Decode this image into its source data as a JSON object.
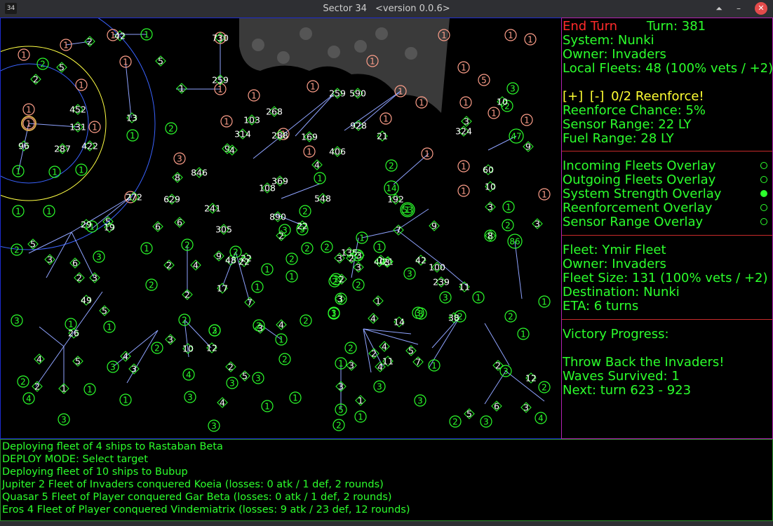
{
  "window": {
    "app_icon_label": "34",
    "title": "Sector 34",
    "version": "<version 0.0.6>",
    "buttons": {
      "pin": "⏶",
      "minimize": "–",
      "close": "✕"
    }
  },
  "status": {
    "end_turn": "End Turn",
    "turn": "Turn: 381",
    "system": "System: Nunki",
    "owner": "Owner: Invaders",
    "local_fleets": "Local Fleets: 48 (100% vets / +2)",
    "reenforce_plus": "[+]",
    "reenforce_minus": "[-]",
    "reenforce": "0/2 Reenforce!",
    "reenforce_chance": "Reenforce Chance: 5%",
    "sensor_range": "Sensor Range: 22 LY",
    "fuel_range": "Fuel Range: 28 LY"
  },
  "overlays": [
    {
      "label": "Incoming Fleets Overlay",
      "selected": false
    },
    {
      "label": "Outgoing Fleets Overlay",
      "selected": false
    },
    {
      "label": "System Strength Overlay",
      "selected": true
    },
    {
      "label": "Reenforcement Overlay",
      "selected": false
    },
    {
      "label": "Sensor Range Overlay",
      "selected": false
    }
  ],
  "fleet": {
    "name": "Fleet: Ymir Fleet",
    "owner": "Owner: Invaders",
    "size": "Fleet Size: 131 (100% vets / +2)",
    "destination": "Destination: Nunki",
    "eta": "ETA: 6 turns"
  },
  "victory": {
    "heading": "Victory Progress:",
    "goal": "Throw Back the Invaders!",
    "waves": "Waves Survived: 1",
    "next": "Next: turn 623 - 923"
  },
  "log": [
    "Deploying fleet of 4 ships to Rastaban Beta",
    "DEPLOY MODE: Select target",
    "Deploying fleet of 10 ships to Bubup",
    "Jupiter 2 Fleet of Invaders conquered Koeia (losses: 0 atk / 1 def, 2 rounds)",
    "Quasar 5 Fleet of Player conquered Gar Beta (losses: 0 atk / 1 def, 2 rounds)",
    "Eros 4 Fleet of Player conquered Vindemiatrix (losses: 9 atk / 23 def, 12 rounds)"
  ],
  "colors": {
    "player": "#2cff2c",
    "invaders": "#ff9f8a",
    "fleet_text": "#ffffff",
    "lanes": "#8fa3ff",
    "panel_border": "#c82b2b",
    "sidebar_border": "#b321b3",
    "map_border": "#1d2bd0",
    "warning": "#ffff33",
    "alert": "#ff2a2a"
  },
  "map": {
    "systems": [
      {
        "owner": "inv",
        "label": "1"
      },
      {
        "owner": "inv",
        "label": "1"
      },
      {
        "owner": "inv",
        "label": "1"
      },
      {
        "owner": "inv",
        "label": "1"
      },
      {
        "owner": "inv",
        "label": "1"
      },
      {
        "owner": "inv",
        "label": "1"
      },
      {
        "owner": "inv",
        "label": "1"
      },
      {
        "owner": "inv",
        "label": "1"
      },
      {
        "owner": "inv",
        "label": "1"
      },
      {
        "owner": "inv",
        "label": "1"
      },
      {
        "owner": "inv",
        "label": "1"
      },
      {
        "owner": "inv",
        "label": "1"
      },
      {
        "owner": "inv",
        "label": "5"
      },
      {
        "owner": "inv",
        "label": "1"
      },
      {
        "owner": "inv",
        "label": "1"
      },
      {
        "owner": "inv",
        "label": "1"
      },
      {
        "owner": "inv",
        "label": "1"
      },
      {
        "owner": "inv",
        "label": "1"
      },
      {
        "owner": "inv",
        "label": "1"
      },
      {
        "owner": "inv",
        "label": "1"
      },
      {
        "owner": "inv",
        "label": "1"
      },
      {
        "owner": "inv",
        "label": "1"
      },
      {
        "owner": "inv",
        "label": "1"
      },
      {
        "owner": "inv",
        "label": "1"
      },
      {
        "owner": "inv",
        "label": "1"
      },
      {
        "owner": "inv",
        "label": "1"
      },
      {
        "owner": "inv",
        "label": "1"
      },
      {
        "owner": "inv",
        "label": "1"
      },
      {
        "owner": "inv",
        "label": "1"
      },
      {
        "owner": "inv",
        "label": "3"
      },
      {
        "owner": "inv",
        "label": "1"
      },
      {
        "owner": "inv",
        "label": "1"
      },
      {
        "owner": "inv",
        "label": "1"
      },
      {
        "owner": "ply",
        "label": "1"
      },
      {
        "owner": "ply",
        "label": "2"
      },
      {
        "owner": "ply",
        "label": "1"
      },
      {
        "owner": "ply",
        "label": "1"
      },
      {
        "owner": "ply",
        "label": "1"
      },
      {
        "owner": "ply",
        "label": "1"
      },
      {
        "owner": "ply",
        "label": "1"
      },
      {
        "owner": "ply",
        "label": "1"
      },
      {
        "owner": "ply",
        "label": "2"
      },
      {
        "owner": "ply",
        "label": "1"
      },
      {
        "owner": "ply",
        "label": "2"
      },
      {
        "owner": "ply",
        "label": "1"
      },
      {
        "owner": "ply",
        "label": "2"
      },
      {
        "owner": "ply",
        "label": "1"
      },
      {
        "owner": "ply",
        "label": "2"
      },
      {
        "owner": "ply",
        "label": "1"
      },
      {
        "owner": "ply",
        "label": "2"
      },
      {
        "owner": "ply",
        "label": "3"
      },
      {
        "owner": "ply",
        "label": "3"
      },
      {
        "owner": "ply",
        "label": "1"
      },
      {
        "owner": "ply",
        "label": "2"
      },
      {
        "owner": "ply",
        "label": "3"
      },
      {
        "owner": "ply",
        "label": "4"
      },
      {
        "owner": "ply",
        "label": "3"
      },
      {
        "owner": "ply",
        "label": "2"
      },
      {
        "owner": "ply",
        "label": "4"
      },
      {
        "owner": "ply",
        "label": "3"
      },
      {
        "owner": "ply",
        "label": "1"
      },
      {
        "owner": "ply",
        "label": "1"
      },
      {
        "owner": "ply",
        "label": "2"
      },
      {
        "owner": "ply",
        "label": "3"
      },
      {
        "owner": "ply",
        "label": "3"
      },
      {
        "owner": "ply",
        "label": "1"
      },
      {
        "owner": "ply",
        "label": "3"
      },
      {
        "owner": "ply",
        "label": "1"
      },
      {
        "owner": "ply",
        "label": "2"
      },
      {
        "owner": "ply",
        "label": "2"
      },
      {
        "owner": "ply",
        "label": "1"
      },
      {
        "owner": "ply",
        "label": "2"
      },
      {
        "owner": "ply",
        "label": "1"
      },
      {
        "owner": "ply",
        "label": "3"
      },
      {
        "owner": "ply",
        "label": "2"
      },
      {
        "owner": "ply",
        "label": "1"
      },
      {
        "owner": "ply",
        "label": "2"
      },
      {
        "owner": "ply",
        "label": "3"
      },
      {
        "owner": "ply",
        "label": "3"
      },
      {
        "owner": "ply",
        "label": "3"
      },
      {
        "owner": "ply",
        "label": "1"
      },
      {
        "owner": "ply",
        "label": "2"
      },
      {
        "owner": "ply",
        "label": "1"
      },
      {
        "owner": "ply",
        "label": "2"
      },
      {
        "owner": "ply",
        "label": "4"
      },
      {
        "owner": "ply",
        "label": "3"
      },
      {
        "owner": "ply",
        "label": "2"
      },
      {
        "owner": "ply",
        "label": "3"
      },
      {
        "owner": "ply",
        "label": "3"
      },
      {
        "owner": "ply",
        "label": "1"
      },
      {
        "owner": "ply",
        "label": "2"
      },
      {
        "owner": "ply",
        "label": "2"
      },
      {
        "owner": "ply",
        "label": "3"
      },
      {
        "owner": "ply",
        "label": "2"
      },
      {
        "owner": "ply",
        "label": "1"
      },
      {
        "owner": "ply",
        "label": "1"
      },
      {
        "owner": "ply",
        "label": "1"
      },
      {
        "owner": "ply",
        "label": "1"
      },
      {
        "owner": "ply",
        "label": "2"
      },
      {
        "owner": "ply",
        "label": "1"
      },
      {
        "owner": "ply",
        "label": "3"
      },
      {
        "owner": "ply",
        "label": "2"
      },
      {
        "owner": "ply",
        "label": "2"
      },
      {
        "owner": "ply",
        "label": "1"
      },
      {
        "owner": "ply",
        "label": "3"
      },
      {
        "owner": "ply",
        "label": "1"
      },
      {
        "owner": "ply",
        "label": "2"
      },
      {
        "owner": "ply",
        "label": "2"
      },
      {
        "owner": "ply",
        "label": "3"
      },
      {
        "owner": "ply",
        "label": "3"
      },
      {
        "owner": "ply",
        "label": "1"
      },
      {
        "owner": "ply",
        "label": "5"
      },
      {
        "owner": "ply",
        "label": "2"
      },
      {
        "owner": "ply",
        "label": "2"
      },
      {
        "owner": "ply",
        "label": "1"
      },
      {
        "owner": "ply",
        "label": "2"
      },
      {
        "owner": "ply",
        "label": "1"
      },
      {
        "owner": "ply",
        "label": "3"
      },
      {
        "owner": "ply",
        "label": "1"
      },
      {
        "owner": "ply",
        "label": "2"
      },
      {
        "owner": "ply",
        "label": "2"
      },
      {
        "owner": "ply",
        "label": "14"
      },
      {
        "owner": "ply",
        "label": "53"
      },
      {
        "owner": "ply",
        "label": "47"
      },
      {
        "owner": "ply",
        "label": "86"
      },
      {
        "owner": "ply",
        "label": "30"
      },
      {
        "owner": "ply",
        "label": "156"
      }
    ],
    "fleet_labels": [
      "2",
      "5",
      "2",
      "5",
      "730",
      "259",
      "1",
      "13",
      "42",
      "5",
      "96",
      "287",
      "452",
      "131",
      "422",
      "268",
      "103",
      "314",
      "288",
      "169",
      "259",
      "590",
      "928",
      "406",
      "369",
      "108",
      "548",
      "4",
      "629",
      "6",
      "6",
      "241",
      "305",
      "22",
      "890",
      "2",
      "22",
      "272",
      "29",
      "19",
      "5",
      "3",
      "6",
      "2",
      "3",
      "49",
      "5",
      "26",
      "5",
      "4",
      "2",
      "1",
      "9",
      "48",
      "22",
      "17",
      "7",
      "2",
      "4",
      "2",
      "4",
      "3",
      "3",
      "10",
      "12",
      "4",
      "3",
      "5",
      "2",
      "4",
      "3",
      "2",
      "7",
      "5",
      "4",
      "4",
      "21",
      "3",
      "135",
      "2",
      "3",
      "14",
      "4",
      "11",
      "7",
      "3",
      "3",
      "1",
      "1",
      "42",
      "100",
      "239",
      "11",
      "38",
      "9",
      "60",
      "9",
      "10",
      "3",
      "3",
      "8",
      "192",
      "40",
      "10",
      "2",
      "12",
      "3",
      "5",
      "6",
      "3",
      "324",
      "8",
      "846",
      "9",
      "4",
      "21",
      "1",
      "3",
      "3",
      "2"
    ]
  }
}
